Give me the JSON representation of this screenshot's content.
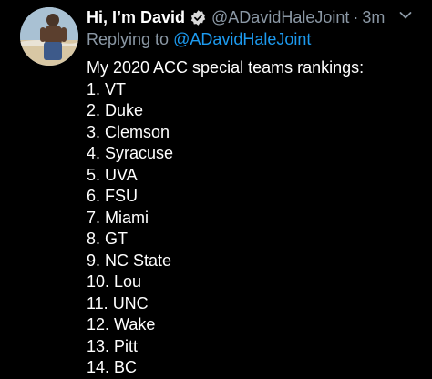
{
  "colors": {
    "background": "#000000",
    "text": "#ffffff",
    "muted": "#8b98a5",
    "link": "#1d9bf0",
    "verified": "#d9d9d9"
  },
  "tweet": {
    "avatar_icon": "profile-photo",
    "display_name": "Hi, I’m David",
    "verified_icon": "verified-badge-icon",
    "handle": "@ADavidHaleJoint",
    "separator": "·",
    "time": "3m",
    "menu_icon": "chevron-down-icon",
    "reply_prefix": "Replying to",
    "reply_handle": "@ADavidHaleJoint",
    "intro": "My 2020 ACC special teams rankings:",
    "rankings": [
      "1. VT",
      "2. Duke",
      "3. Clemson",
      "4. Syracuse",
      "5. UVA",
      "6. FSU",
      "7. Miami",
      "8. GT",
      "9. NC State",
      "10. Lou",
      "11. UNC",
      "12. Wake",
      "13. Pitt",
      "14. BC"
    ]
  }
}
